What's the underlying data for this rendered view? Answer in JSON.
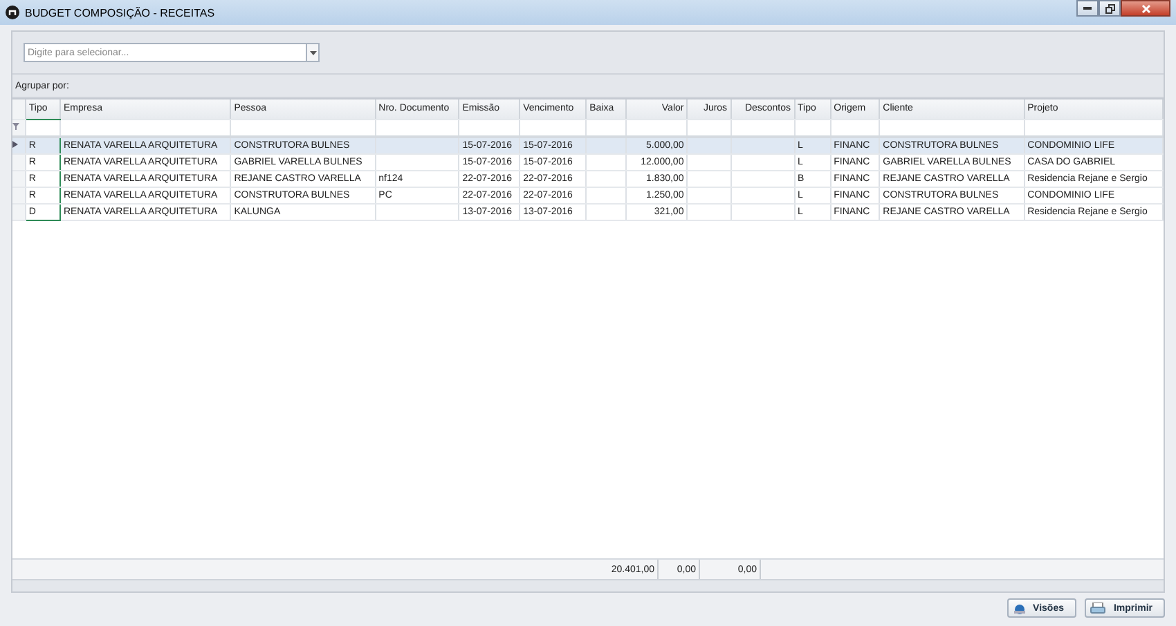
{
  "window": {
    "title": "BUDGET COMPOSIÇÃO - RECEITAS"
  },
  "search": {
    "placeholder": "Digite para selecionar..."
  },
  "group_by": {
    "label": "Agrupar por:"
  },
  "table": {
    "columns": [
      {
        "label": "Tipo",
        "kind": "text",
        "focused": true
      },
      {
        "label": "Empresa",
        "kind": "text",
        "focused": false
      },
      {
        "label": "Pessoa",
        "kind": "text",
        "focused": false
      },
      {
        "label": "Nro. Documento",
        "kind": "text",
        "focused": false
      },
      {
        "label": "Emissão",
        "kind": "text",
        "focused": false
      },
      {
        "label": "Vencimento",
        "kind": "text",
        "focused": false
      },
      {
        "label": "Baixa",
        "kind": "text",
        "focused": false
      },
      {
        "label": "Valor",
        "kind": "number",
        "focused": false,
        "total": "20.401,00"
      },
      {
        "label": "Juros",
        "kind": "number",
        "focused": false,
        "total": "0,00"
      },
      {
        "label": "Descontos",
        "kind": "number",
        "focused": false,
        "total": "0,00"
      },
      {
        "label": "Tipo",
        "kind": "text",
        "focused": false
      },
      {
        "label": "Origem",
        "kind": "text",
        "focused": false
      },
      {
        "label": "Cliente",
        "kind": "text",
        "focused": false
      },
      {
        "label": "Projeto",
        "kind": "text",
        "focused": false
      }
    ],
    "rows": [
      {
        "selected": true,
        "cells": [
          "R",
          "RENATA VARELLA ARQUITETURA",
          "CONSTRUTORA BULNES",
          null,
          "15-07-2016",
          "15-07-2016",
          null,
          "5.000,00",
          null,
          null,
          "L",
          "FINANC",
          "CONSTRUTORA BULNES",
          "CONDOMINIO LIFE"
        ]
      },
      {
        "selected": false,
        "cells": [
          "R",
          "RENATA VARELLA ARQUITETURA",
          "GABRIEL VARELLA BULNES",
          null,
          "15-07-2016",
          "15-07-2016",
          null,
          "12.000,00",
          null,
          null,
          "L",
          "FINANC",
          "GABRIEL VARELLA BULNES",
          "CASA DO GABRIEL"
        ]
      },
      {
        "selected": false,
        "cells": [
          "R",
          "RENATA VARELLA ARQUITETURA",
          "REJANE CASTRO VARELLA",
          "nf124",
          "22-07-2016",
          "22-07-2016",
          null,
          "1.830,00",
          null,
          null,
          "B",
          "FINANC",
          "REJANE CASTRO VARELLA",
          "Residencia Rejane e Sergio"
        ]
      },
      {
        "selected": false,
        "cells": [
          "R",
          "RENATA VARELLA ARQUITETURA",
          "CONSTRUTORA BULNES",
          "PC",
          "22-07-2016",
          "22-07-2016",
          null,
          "1.250,00",
          null,
          null,
          "L",
          "FINANC",
          "CONSTRUTORA BULNES",
          "CONDOMINIO LIFE"
        ]
      },
      {
        "selected": false,
        "cells": [
          "D",
          "RENATA VARELLA ARQUITETURA",
          "KALUNGA",
          null,
          "13-07-2016",
          "13-07-2016",
          null,
          "321,00",
          null,
          null,
          "L",
          "FINANC",
          "REJANE CASTRO VARELLA",
          "Residencia Rejane e Sergio"
        ]
      }
    ]
  },
  "buttons": [
    {
      "kind": "views",
      "label": "Visões"
    },
    {
      "kind": "print",
      "label": "Imprimir"
    }
  ]
}
